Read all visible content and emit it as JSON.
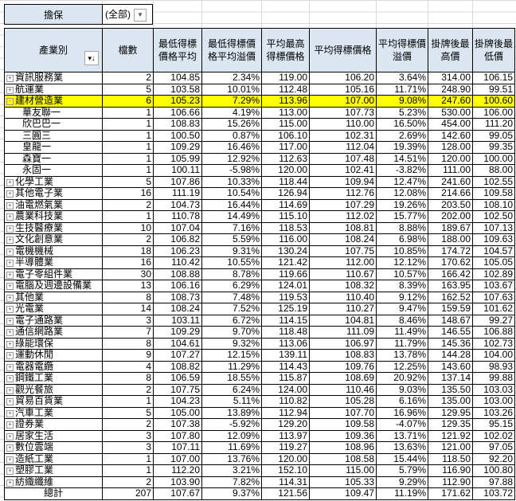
{
  "filter": {
    "label": "擔保",
    "value": "(全部)"
  },
  "headers": [
    "產業別",
    "檔數",
    "最低得標價格平均",
    "最低得標價格平均溢價",
    "平均最高得標價格",
    "平均得標價格",
    "平均得標價溢價",
    "掛牌後最高價",
    "掛牌後最低價"
  ],
  "highlight_color": "#ffff00",
  "rows": [
    {
      "type": "group",
      "toggle": "+",
      "name": "資訊服務業",
      "v": [
        "2",
        "104.85",
        "2.34%",
        "119.00",
        "106.20",
        "3.64%",
        "314.00",
        "106.15"
      ]
    },
    {
      "type": "group",
      "toggle": "+",
      "name": "航運業",
      "v": [
        "5",
        "103.58",
        "10.01%",
        "112.48",
        "105.16",
        "11.71%",
        "248.90",
        "99.51"
      ]
    },
    {
      "type": "group",
      "toggle": "-",
      "highlight": true,
      "name": "建材營造業",
      "v": [
        "6",
        "105.23",
        "7.29%",
        "113.96",
        "107.00",
        "9.08%",
        "247.60",
        "100.60"
      ]
    },
    {
      "type": "child",
      "name": "華友聯一",
      "v": [
        "1",
        "106.66",
        "4.19%",
        "113.00",
        "107.73",
        "5.23%",
        "530.00",
        "106.00"
      ]
    },
    {
      "type": "child",
      "name": "欣巴巴一",
      "v": [
        "1",
        "108.83",
        "15.26%",
        "115.00",
        "110.00",
        "16.50%",
        "454.00",
        "111.20"
      ]
    },
    {
      "type": "child",
      "name": "三圓三",
      "v": [
        "1",
        "100.50",
        "0.87%",
        "106.10",
        "102.31",
        "2.69%",
        "142.60",
        "99.05"
      ]
    },
    {
      "type": "child",
      "name": "皇龍一",
      "v": [
        "1",
        "109.29",
        "16.46%",
        "117.00",
        "112.04",
        "19.39%",
        "128.00",
        "99.35"
      ]
    },
    {
      "type": "child",
      "name": "森寶一",
      "v": [
        "1",
        "105.99",
        "12.92%",
        "112.63",
        "107.48",
        "14.51%",
        "120.00",
        "100.00"
      ]
    },
    {
      "type": "child",
      "name": "永固一",
      "v": [
        "1",
        "100.11",
        "-5.98%",
        "120.00",
        "102.41",
        "-3.82%",
        "111.00",
        "88.00"
      ]
    },
    {
      "type": "group",
      "toggle": "+",
      "name": "化學工業",
      "v": [
        "5",
        "107.86",
        "10.33%",
        "118.44",
        "109.94",
        "12.47%",
        "241.60",
        "102.55"
      ]
    },
    {
      "type": "group",
      "toggle": "+",
      "name": "其他電子業",
      "v": [
        "16",
        "111.19",
        "10.54%",
        "126.94",
        "112.76",
        "12.08%",
        "214.66",
        "109.58"
      ]
    },
    {
      "type": "group",
      "toggle": "+",
      "name": "油電燃氣業",
      "v": [
        "2",
        "104.73",
        "16.44%",
        "114.69",
        "107.29",
        "19.26%",
        "203.50",
        "108.10"
      ]
    },
    {
      "type": "group",
      "toggle": "+",
      "name": "農業科技業",
      "v": [
        "1",
        "110.78",
        "14.49%",
        "115.10",
        "112.02",
        "15.77%",
        "202.00",
        "102.50"
      ]
    },
    {
      "type": "group",
      "toggle": "+",
      "name": "生技醫療業",
      "v": [
        "10",
        "107.04",
        "7.16%",
        "118.53",
        "108.81",
        "8.88%",
        "189.67",
        "107.13"
      ]
    },
    {
      "type": "group",
      "toggle": "+",
      "name": "文化創意業",
      "v": [
        "2",
        "106.82",
        "5.59%",
        "116.00",
        "108.24",
        "6.98%",
        "188.00",
        "109.63"
      ]
    },
    {
      "type": "group",
      "toggle": "+",
      "name": "電機機械",
      "v": [
        "18",
        "106.23",
        "9.31%",
        "130.24",
        "107.75",
        "10.85%",
        "174.72",
        "104.57"
      ]
    },
    {
      "type": "group",
      "toggle": "+",
      "name": "半導體業",
      "v": [
        "16",
        "110.42",
        "10.55%",
        "121.42",
        "112.00",
        "12.12%",
        "170.62",
        "105.05"
      ]
    },
    {
      "type": "group",
      "toggle": "+",
      "name": "電子零組件業",
      "v": [
        "30",
        "108.88",
        "8.78%",
        "119.66",
        "110.67",
        "10.57%",
        "166.42",
        "102.89"
      ]
    },
    {
      "type": "group",
      "toggle": "+",
      "name": "電腦及週邊設備業",
      "v": [
        "13",
        "106.16",
        "6.29%",
        "124.01",
        "108.32",
        "8.39%",
        "163.95",
        "103.67"
      ]
    },
    {
      "type": "group",
      "toggle": "+",
      "name": "其他業",
      "v": [
        "8",
        "108.73",
        "7.48%",
        "119.53",
        "110.40",
        "9.12%",
        "162.52",
        "107.63"
      ]
    },
    {
      "type": "group",
      "toggle": "+",
      "name": "光電業",
      "v": [
        "14",
        "108.24",
        "7.52%",
        "125.19",
        "110.27",
        "9.47%",
        "159.59",
        "101.62"
      ]
    },
    {
      "type": "group",
      "toggle": "+",
      "name": "電子通路業",
      "v": [
        "3",
        "103.11",
        "6.72%",
        "114.15",
        "104.81",
        "8.46%",
        "148.67",
        "99.27"
      ]
    },
    {
      "type": "group",
      "toggle": "+",
      "name": "通信網路業",
      "v": [
        "7",
        "109.29",
        "9.70%",
        "118.48",
        "111.09",
        "11.49%",
        "146.55",
        "106.88"
      ]
    },
    {
      "type": "group",
      "toggle": "+",
      "name": "綠能環保",
      "v": [
        "8",
        "104.61",
        "9.32%",
        "113.06",
        "106.97",
        "11.79%",
        "145.36",
        "102.73"
      ]
    },
    {
      "type": "group",
      "toggle": "+",
      "name": "運動休閒",
      "v": [
        "9",
        "107.27",
        "12.15%",
        "139.11",
        "108.83",
        "13.78%",
        "144.28",
        "104.00"
      ]
    },
    {
      "type": "group",
      "toggle": "+",
      "name": "電器電纜",
      "v": [
        "4",
        "108.82",
        "11.29%",
        "114.43",
        "109.76",
        "12.25%",
        "143.60",
        "98.93"
      ]
    },
    {
      "type": "group",
      "toggle": "+",
      "name": "鋼鐵工業",
      "v": [
        "8",
        "106.59",
        "18.55%",
        "115.87",
        "108.69",
        "20.92%",
        "137.14",
        "99.88"
      ]
    },
    {
      "type": "group",
      "toggle": "+",
      "name": "觀光餐旅",
      "v": [
        "2",
        "107.75",
        "6.24%",
        "124.00",
        "110.46",
        "9.03%",
        "135.50",
        "103.03"
      ]
    },
    {
      "type": "group",
      "toggle": "+",
      "name": "貿易百貨業",
      "v": [
        "1",
        "104.23",
        "5.11%",
        "110.82",
        "105.28",
        "6.16%",
        "135.00",
        "103.00"
      ]
    },
    {
      "type": "group",
      "toggle": "+",
      "name": "汽車工業",
      "v": [
        "5",
        "105.00",
        "13.89%",
        "112.94",
        "107.70",
        "16.96%",
        "129.95",
        "103.26"
      ]
    },
    {
      "type": "group",
      "toggle": "+",
      "name": "證券業",
      "v": [
        "2",
        "107.38",
        "-5.92%",
        "129.20",
        "109.58",
        "-4.07%",
        "129.35",
        "95.15"
      ]
    },
    {
      "type": "group",
      "toggle": "+",
      "name": "居家生活",
      "v": [
        "3",
        "107.80",
        "12.09%",
        "113.97",
        "109.36",
        "13.71%",
        "121.92",
        "102.02"
      ]
    },
    {
      "type": "group",
      "toggle": "+",
      "name": "數位雲端",
      "v": [
        "3",
        "107.11",
        "11.69%",
        "119.27",
        "108.96",
        "13.63%",
        "121.00",
        "97.05"
      ]
    },
    {
      "type": "group",
      "toggle": "+",
      "name": "造紙工業",
      "v": [
        "1",
        "107.00",
        "13.76%",
        "120.00",
        "108.58",
        "15.44%",
        "118.50",
        "92.20"
      ]
    },
    {
      "type": "group",
      "toggle": "+",
      "name": "塑膠工業",
      "v": [
        "1",
        "112.20",
        "3.21%",
        "152.10",
        "115.00",
        "5.79%",
        "116.90",
        "100.80"
      ]
    },
    {
      "type": "group",
      "toggle": "+",
      "name": "紡織纖維",
      "v": [
        "2",
        "103.90",
        "7.82%",
        "114.31",
        "105.33",
        "9.29%",
        "112.90",
        "97.88"
      ]
    },
    {
      "type": "total",
      "name": "總計",
      "v": [
        "207",
        "107.67",
        "9.37%",
        "121.56",
        "109.47",
        "11.19%",
        "171.62",
        "103.72"
      ]
    }
  ]
}
